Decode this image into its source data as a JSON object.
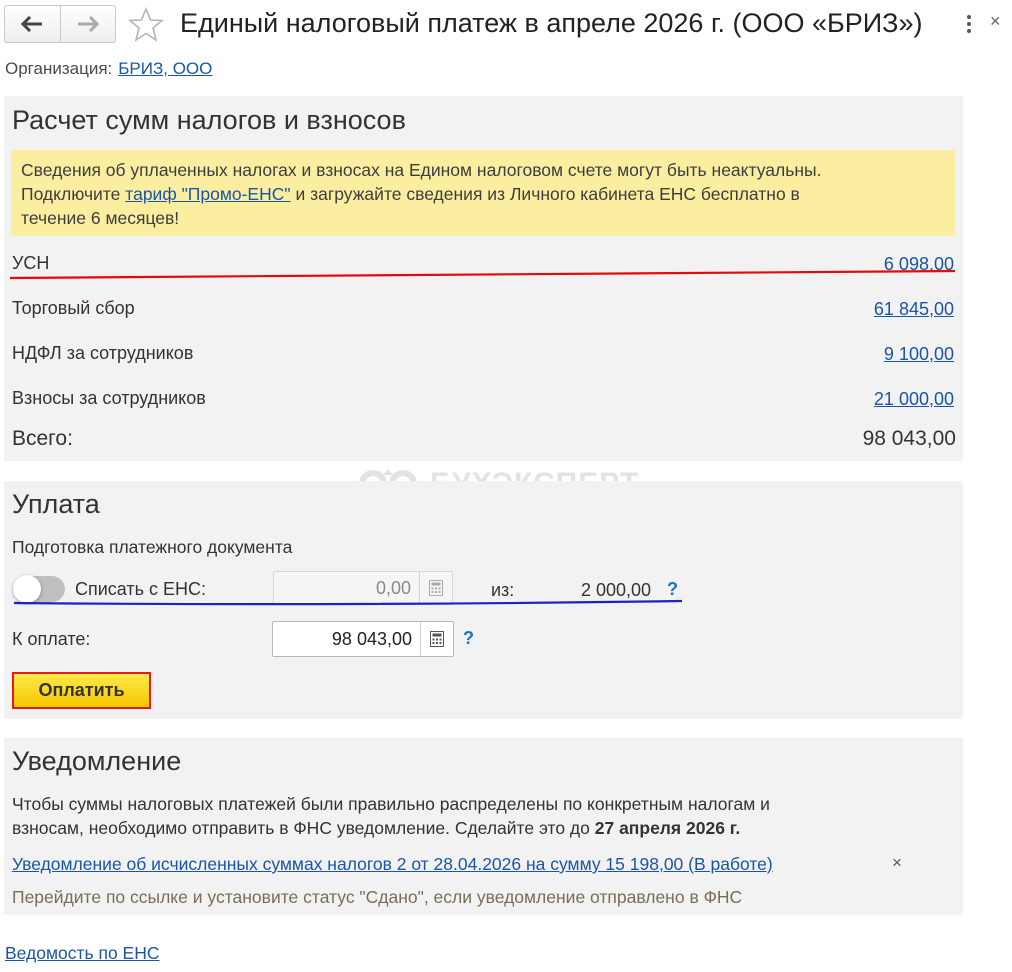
{
  "window": {
    "title": "Единый налоговый платеж в апреле 2026 г. (ООО «БРИЗ»)",
    "close": "×"
  },
  "org": {
    "label": "Организация:",
    "value": "БРИЗ, ООО"
  },
  "calc": {
    "title": "Расчет сумм налогов и взносов",
    "notice": {
      "line1": "Сведения об уплаченных налогах и взносах на Едином налоговом счете могут быть неактуальны.",
      "pre": "Подключите",
      "link": "тариф \"Промо-ЕНС\"",
      "post": "и загружайте сведения из Личного кабинета ЕНС бесплатно в",
      "line3": "течение 6 месяцев!"
    },
    "rows": [
      {
        "label": "УСН",
        "value": "6 098,00"
      },
      {
        "label": "Торговый сбор",
        "value": "61 845,00"
      },
      {
        "label": "НДФЛ за сотрудников",
        "value": "9 100,00"
      },
      {
        "label": "Взносы за сотрудников",
        "value": "21 000,00"
      }
    ],
    "total_label": "Всего:",
    "total_value": "98 043,00"
  },
  "watermark": "БУХЭКСПЕРТ",
  "payment": {
    "title": "Уплата",
    "subtitle": "Подготовка платежного документа",
    "toggle_label": "Списать с ЕНС:",
    "ens_value": "0,00",
    "from_label": "из:",
    "from_value": "2 000,00",
    "help": "?",
    "topay_label": "К оплате:",
    "topay_value": "98 043,00",
    "pay_button": "Оплатить"
  },
  "notification": {
    "title": "Уведомление",
    "text_line1": "Чтобы суммы налоговых платежей были правильно распределены по конкретным налогам и",
    "text_line2": "взносам, необходимо отправить в ФНС уведомление. Сделайте это до",
    "deadline": "27 апреля 2026 г.",
    "link": "Уведомление об исчисленных суммах налогов 2 от 28.04.2026 на сумму 15 198,00 (В работе)",
    "dismiss": "×",
    "hint": "Перейдите по ссылке и установите статус \"Сдано\", если уведомление отправлено в ФНС"
  },
  "footer_link": "Ведомость по ЕНС",
  "colors": {
    "accent_red": "#e20a0a",
    "accent_blue": "#1e20c8",
    "notice_bg": "#fbeea0",
    "button_yellow": "#f6c800"
  }
}
